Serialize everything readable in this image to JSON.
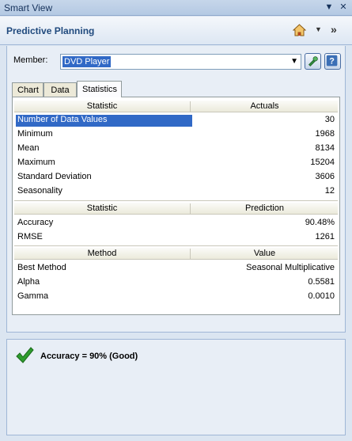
{
  "window": {
    "title": "Smart View"
  },
  "header": {
    "title": "Predictive Planning"
  },
  "member": {
    "label": "Member:",
    "value": "DVD Player"
  },
  "tabs": [
    {
      "label": "Chart"
    },
    {
      "label": "Data"
    },
    {
      "label": "Statistics"
    }
  ],
  "stats": {
    "section1": {
      "col1": "Statistic",
      "col2": "Actuals",
      "rows": [
        {
          "label": "Number of Data Values",
          "value": "30"
        },
        {
          "label": "Minimum",
          "value": "1968"
        },
        {
          "label": "Mean",
          "value": "8134"
        },
        {
          "label": "Maximum",
          "value": "15204"
        },
        {
          "label": "Standard Deviation",
          "value": "3606"
        },
        {
          "label": "Seasonality",
          "value": "12"
        }
      ]
    },
    "section2": {
      "col1": "Statistic",
      "col2": "Prediction",
      "rows": [
        {
          "label": "Accuracy",
          "value": "90.48%"
        },
        {
          "label": "RMSE",
          "value": "1261"
        }
      ]
    },
    "section3": {
      "col1": "Method",
      "col2": "Value",
      "rows": [
        {
          "label": "Best Method",
          "value": "Seasonal Multiplicative"
        },
        {
          "label": "Alpha",
          "value": "0.5581"
        },
        {
          "label": "Gamma",
          "value": "0.0010"
        }
      ]
    }
  },
  "result": {
    "message": "Accuracy = 90% (Good)",
    "icon": "checkmark-icon",
    "color": "#2e9c2e"
  }
}
